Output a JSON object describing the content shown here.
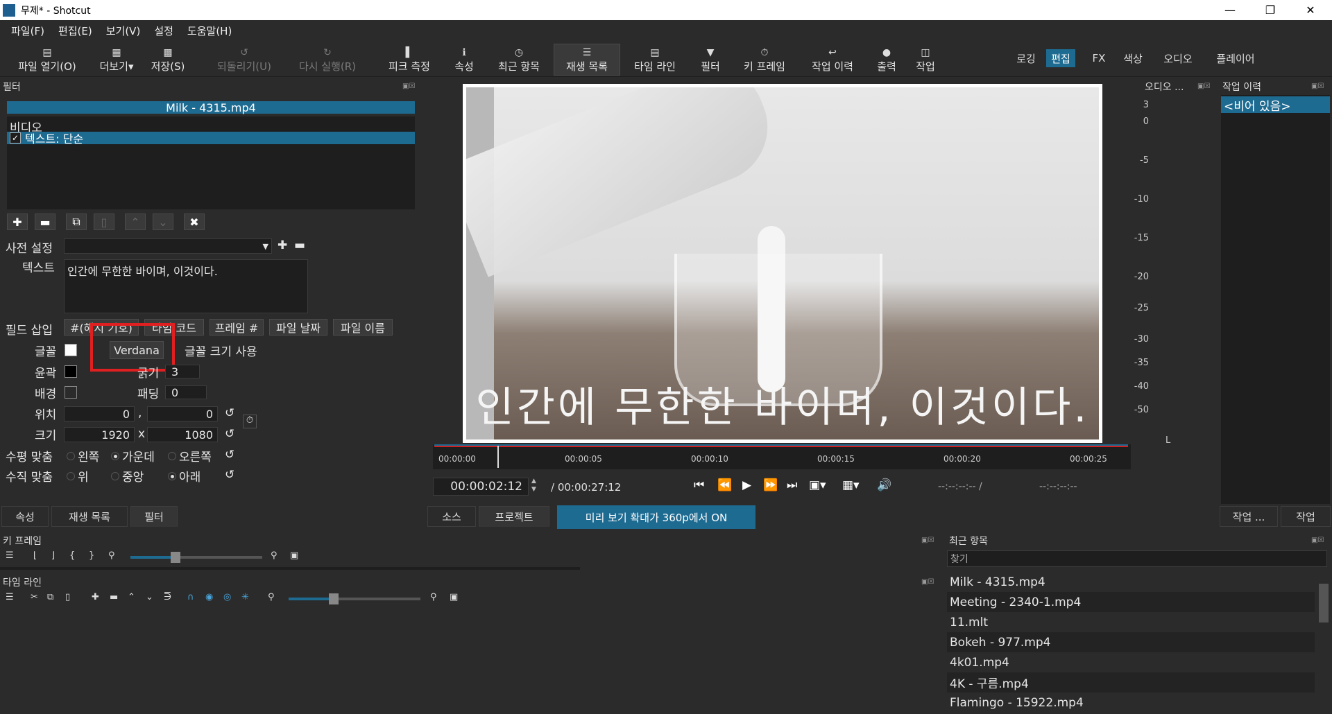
{
  "window": {
    "title": "무제* - Shotcut"
  },
  "menu": [
    "파일(F)",
    "편집(E)",
    "보기(V)",
    "설정",
    "도움말(H)"
  ],
  "toolbar": {
    "open": "파일 열기(O)",
    "more": "더보기",
    "save": "저장(S)",
    "undo": "되돌리기(U)",
    "redo": "다시 실행(R)",
    "peak": "피크 측정",
    "properties": "속성",
    "recent": "최근 항목",
    "playlist": "재생 목록",
    "timeline": "타임 라인",
    "filters": "필터",
    "keyframes": "키 프레임",
    "history": "작업 이력",
    "export": "출력",
    "jobs": "작업"
  },
  "workspaces": {
    "logging": "로깅",
    "editing": "편집",
    "fx": "FX",
    "color": "색상",
    "audio": "오디오",
    "player": "플레이어"
  },
  "filters_panel": {
    "header": "필터",
    "clip_name": "Milk - 4315.mp4",
    "category": "비디오",
    "item": "텍스트: 단순",
    "item_checked": "✓",
    "preset_label": "사전 설정",
    "text_label": "텍스트",
    "text_value": "인간에 무한한 바이며, 이것이다.",
    "insert_label": "필드 삽입",
    "insert_buttons": [
      "#(해시 기호)",
      "타임 코드",
      "프레임 #",
      "파일 날짜",
      "파일 이름"
    ],
    "font_label": "글꼴",
    "font_button": "Verdana",
    "use_font_size": "글꼴 크기 사용",
    "outline_label": "윤곽",
    "thickness_label": "굵기",
    "thickness_value": "3",
    "bg_label": "배경",
    "padding_label": "패딩",
    "padding_value": "0",
    "position_label": "위치",
    "pos_x": "0",
    "pos_y": "0",
    "size_label": "크기",
    "size_w": "1920",
    "size_h": "1080",
    "size_sep": "x",
    "pos_sep": ",",
    "halign_label": "수평 맞춤",
    "halign_options": [
      "왼쪽",
      "가운데",
      "오른쪽"
    ],
    "valign_label": "수직 맞춤",
    "valign_options": [
      "위",
      "중앙",
      "아래"
    ]
  },
  "left_tabs": [
    "속성",
    "재생 목록",
    "필터"
  ],
  "player": {
    "subtitle": "인간에 무한한 바이며, 이것이다.",
    "ruler": [
      "00:00:00",
      "00:00:05",
      "00:00:10",
      "00:00:15",
      "00:00:20",
      "00:00:25"
    ],
    "timecode": "00:00:02:12",
    "duration": "/ 00:00:27:12",
    "in_point": "--:--:--:-- /",
    "out_point": "--:--:--:--",
    "tab_source": "소스",
    "tab_project": "프로젝트",
    "preview_scale": "미리 보기 확대가 360p에서 ON"
  },
  "audio_meter": {
    "header": "오디오 ...",
    "labels": [
      "3",
      "0",
      "-5",
      "-10",
      "-15",
      "-20",
      "-25",
      "-30",
      "-35",
      "-40",
      "-50"
    ],
    "channel": "L"
  },
  "history": {
    "header": "작업 이력",
    "item": "<비어 있음>",
    "btn1": "작업 ...",
    "btn2": "작업"
  },
  "keyframes": {
    "header": "키 프레임"
  },
  "timeline": {
    "header": "타임 라인"
  },
  "recent": {
    "header": "최근 항목",
    "search_placeholder": "찾기",
    "items": [
      "Milk - 4315.mp4",
      "Meeting - 2340-1.mp4",
      "11.mlt",
      "Bokeh - 977.mp4",
      "4k01.mp4",
      "4K - 구름.mp4",
      "Flamingo - 15922.mp4"
    ]
  },
  "colors": {
    "accent": "#1e6b92",
    "highlight_box": "#e02020",
    "bg": "#2b2b2b"
  }
}
